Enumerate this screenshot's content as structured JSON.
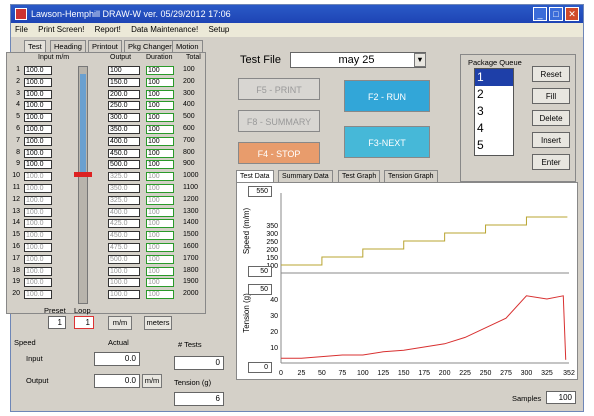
{
  "window": {
    "title": "Lawson-Hemphill DRAW-W  ver. 05/29/2012 17:06",
    "min": "_",
    "max": "□",
    "close": "✕"
  },
  "menu": [
    "File",
    "Print Screen!",
    "Report!",
    "Data Maintenance!",
    "Setup"
  ],
  "tabs": [
    "Test",
    "Heading",
    "Printout",
    "Pkg Changer",
    "Motion"
  ],
  "table": {
    "headers": {
      "input": "Input m/m",
      "output": "Output",
      "duration": "Duration",
      "total": "Total"
    },
    "rows": [
      {
        "n": "1",
        "input": "100.0",
        "output": "100",
        "duration": "100",
        "total": "100"
      },
      {
        "n": "2",
        "input": "100.0",
        "output": "150.0",
        "duration": "100",
        "total": "200"
      },
      {
        "n": "3",
        "input": "100.0",
        "output": "200.0",
        "duration": "100",
        "total": "300"
      },
      {
        "n": "4",
        "input": "100.0",
        "output": "250.0",
        "duration": "100",
        "total": "400"
      },
      {
        "n": "5",
        "input": "100.0",
        "output": "300.0",
        "duration": "100",
        "total": "500"
      },
      {
        "n": "6",
        "input": "100.0",
        "output": "350.0",
        "duration": "100",
        "total": "600"
      },
      {
        "n": "7",
        "input": "100.0",
        "output": "400.0",
        "duration": "100",
        "total": "700"
      },
      {
        "n": "8",
        "input": "100.0",
        "output": "450.0",
        "duration": "100",
        "total": "800"
      },
      {
        "n": "9",
        "input": "100.0",
        "output": "500.0",
        "duration": "100",
        "total": "900"
      },
      {
        "n": "10",
        "input": "100.0",
        "output": "325.0",
        "duration": "100",
        "total": "1000"
      },
      {
        "n": "11",
        "input": "100.0",
        "output": "350.0",
        "duration": "100",
        "total": "1100"
      },
      {
        "n": "12",
        "input": "100.0",
        "output": "325.0",
        "duration": "100",
        "total": "1200"
      },
      {
        "n": "13",
        "input": "100.0",
        "output": "400.0",
        "duration": "100",
        "total": "1300"
      },
      {
        "n": "14",
        "input": "100.0",
        "output": "425.0",
        "duration": "100",
        "total": "1400"
      },
      {
        "n": "15",
        "input": "100.0",
        "output": "450.0",
        "duration": "100",
        "total": "1500"
      },
      {
        "n": "16",
        "input": "100.0",
        "output": "475.0",
        "duration": "100",
        "total": "1600"
      },
      {
        "n": "17",
        "input": "100.0",
        "output": "500.0",
        "duration": "100",
        "total": "1700"
      },
      {
        "n": "18",
        "input": "100.0",
        "output": "100.0",
        "duration": "100",
        "total": "1800"
      },
      {
        "n": "19",
        "input": "100.0",
        "output": "100.0",
        "duration": "100",
        "total": "1900"
      },
      {
        "n": "20",
        "input": "100.0",
        "output": "100.0",
        "duration": "100",
        "total": "2000"
      }
    ]
  },
  "preset": {
    "label": "Preset",
    "value": "1"
  },
  "loop": {
    "label": "Loop",
    "value": "1"
  },
  "mm_btn": "m/m",
  "meters_btn": "meters",
  "speed": {
    "label": "Speed",
    "actual": "Actual",
    "input_label": "Input",
    "input_value": "0.0",
    "output_label": "Output",
    "output_value": "0.0",
    "unit_btn": "m/m"
  },
  "tests": {
    "label": "# Tests",
    "value": "0"
  },
  "tension": {
    "label": "Tension (g)",
    "value": "6"
  },
  "testfile": {
    "label": "Test File",
    "value": "may 25"
  },
  "buttons": {
    "print": "F5 - PRINT",
    "run": "F2 - RUN",
    "summary": "F8 - SUMMARY",
    "stop": "F4 - STOP",
    "next": "F3-NEXT"
  },
  "pkg": {
    "title": "Package Queue",
    "items": [
      "1",
      "2",
      "3",
      "4",
      "5"
    ],
    "reset": "Reset",
    "fill": "Fill",
    "delete": "Delete",
    "insert": "Insert",
    "enter": "Enter"
  },
  "chart_tabs": [
    "Test Data",
    "Summary Data",
    "Test Graph",
    "Tension Graph"
  ],
  "chart_data": {
    "type": "line",
    "speed": {
      "ylabel": "Speed (m/m)",
      "ymax_box": "550",
      "ymin_box": "50",
      "ticks": [
        "350",
        "300",
        "250",
        "200",
        "150",
        "100"
      ]
    },
    "tension": {
      "ylabel": "Tension (g)",
      "ymax_box": "50",
      "ymin_box": "0",
      "ticks": [
        "40",
        "30",
        "20",
        "10"
      ]
    },
    "xticks": [
      "0",
      "25",
      "50",
      "75",
      "100",
      "125",
      "150",
      "175",
      "200",
      "225",
      "250",
      "275",
      "300",
      "325",
      "352"
    ],
    "speed_series": [
      [
        0,
        100
      ],
      [
        50,
        100
      ],
      [
        50,
        150
      ],
      [
        100,
        150
      ],
      [
        100,
        200
      ],
      [
        150,
        200
      ],
      [
        150,
        250
      ],
      [
        200,
        250
      ],
      [
        200,
        300
      ],
      [
        250,
        300
      ],
      [
        250,
        350
      ],
      [
        300,
        350
      ],
      [
        300,
        400
      ],
      [
        350,
        400
      ]
    ],
    "tension_series": [
      [
        0,
        3
      ],
      [
        25,
        3
      ],
      [
        50,
        4
      ],
      [
        75,
        5
      ],
      [
        100,
        5
      ],
      [
        125,
        7
      ],
      [
        150,
        8
      ],
      [
        175,
        10
      ],
      [
        200,
        12
      ],
      [
        225,
        16
      ],
      [
        250,
        22
      ],
      [
        275,
        28
      ],
      [
        300,
        42
      ],
      [
        325,
        40
      ],
      [
        345,
        42
      ],
      [
        348,
        2
      ]
    ]
  },
  "samples": {
    "label": "Samples",
    "value": "100"
  }
}
